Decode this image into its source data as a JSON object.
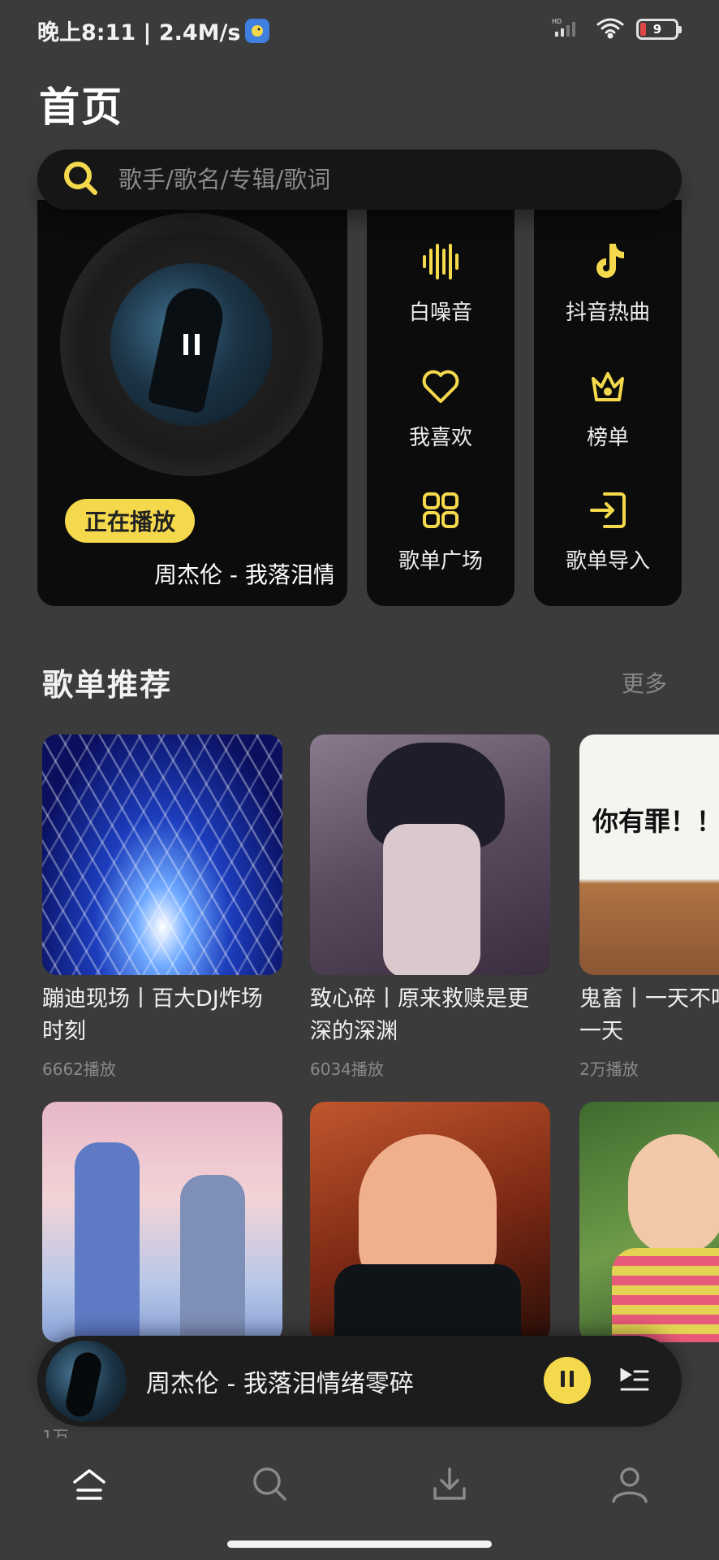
{
  "status_bar": {
    "time_speed": "晚上8:11 | 2.4M/s",
    "battery": "9"
  },
  "header": {
    "title": "首页"
  },
  "search": {
    "placeholder": "歌手/歌名/专辑/歌词"
  },
  "now_playing_card": {
    "badge": "正在播放",
    "song": "周杰伦 - 我落泪情绪零碎"
  },
  "quick_grid": [
    {
      "label": "白噪音",
      "icon": "soundwave-icon"
    },
    {
      "label": "抖音热曲",
      "icon": "tiktok-note-icon"
    },
    {
      "label": "我喜欢",
      "icon": "heart-icon"
    },
    {
      "label": "榜单",
      "icon": "crown-icon"
    },
    {
      "label": "歌单广场",
      "icon": "grid-icon"
    },
    {
      "label": "歌单导入",
      "icon": "import-icon"
    }
  ],
  "recommend": {
    "title": "歌单推荐",
    "more": "更多",
    "playlists": [
      {
        "name": "蹦迪现场丨百大DJ炸场时刻",
        "plays": "6662播放"
      },
      {
        "name": "致心碎丨原来救赎是更深的深渊",
        "plays": "6034播放"
      },
      {
        "name": "鬼畜丨一天不听了难受一天",
        "plays": "2万播放",
        "cover_text": "你有罪！！"
      },
      {
        "name": "",
        "plays": "1万"
      },
      {
        "name": "",
        "plays": ""
      },
      {
        "name": "丨",
        "plays": ""
      }
    ]
  },
  "mini_player": {
    "title": "周杰伦 - 我落泪情绪零碎"
  },
  "bottom_nav": [
    {
      "icon": "home-icon"
    },
    {
      "icon": "search-icon"
    },
    {
      "icon": "download-icon"
    },
    {
      "icon": "profile-icon"
    }
  ],
  "colors": {
    "background": "#3b3b3b",
    "card": "#0c0c0c",
    "accent": "#f5d94c"
  }
}
